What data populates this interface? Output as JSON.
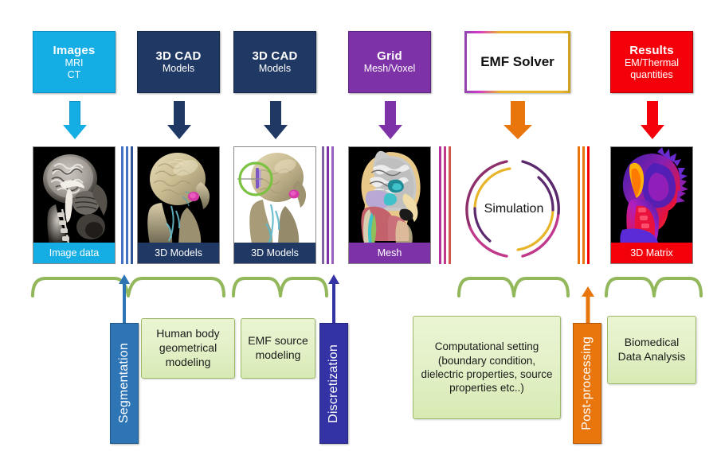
{
  "diagram": {
    "title": "EMF biomedical simulation workflow"
  },
  "sources": [
    {
      "id": "images",
      "t1": "Images",
      "t2": "MRI",
      "t3": "CT",
      "color": "#14ADE4",
      "theme": "cyan"
    },
    {
      "id": "cad1",
      "t1": "3D CAD",
      "t2": "Models",
      "t3": "",
      "color": "#1F3864",
      "theme": "navy"
    },
    {
      "id": "cad2",
      "t1": "3D CAD",
      "t2": "Models",
      "t3": "",
      "color": "#1F3864",
      "theme": "navy"
    },
    {
      "id": "grid",
      "t1": "Grid",
      "t2": "Mesh/Voxel",
      "t3": "",
      "color": "#7E32A8",
      "theme": "purple"
    },
    {
      "id": "solver",
      "t1": "EMF Solver",
      "t2": "",
      "t3": "",
      "color": "#E8B52A",
      "theme": "solver"
    },
    {
      "id": "results",
      "t1": "Results",
      "t2": "EM/Thermal",
      "t3": "quantities",
      "color": "#F4000B",
      "theme": "red"
    }
  ],
  "arrows_down": [
    {
      "for": "images",
      "color": "#14ADE4"
    },
    {
      "for": "cad1",
      "color": "#1F3864"
    },
    {
      "for": "cad2",
      "color": "#1F3864"
    },
    {
      "for": "grid",
      "color": "#7E32A8"
    },
    {
      "for": "solver",
      "color": "#E8760C"
    },
    {
      "for": "results",
      "color": "#F4000B"
    }
  ],
  "panels": [
    {
      "id": "imagedata",
      "caption": "Image data",
      "theme": "cyan",
      "art": "mri-sagittal-scan"
    },
    {
      "id": "model1",
      "caption": "3D Models",
      "theme": "navy",
      "art": "head-3d-model"
    },
    {
      "id": "model2",
      "caption": "3D Models",
      "theme": "navy",
      "art": "head-3d-model-with-source"
    },
    {
      "id": "mesh",
      "caption": "Mesh",
      "theme": "purple",
      "art": "segmented-head-mesh"
    },
    {
      "id": "matrix",
      "caption": "3D Matrix",
      "theme": "red",
      "art": "thermal-em-field-map"
    }
  ],
  "simulation": {
    "label": "Simulation",
    "ring_colors": [
      "#E8B52A",
      "#C0398A",
      "#5B2A6E",
      "#8E2F6B"
    ]
  },
  "separators": [
    {
      "after": "imagedata",
      "colors": [
        "#4472C4",
        "#4472C4",
        "#2F5597"
      ]
    },
    {
      "after": "model2",
      "colors": [
        "#8064A2",
        "#7E32A8",
        "#9B5FBF"
      ]
    },
    {
      "after": "mesh",
      "colors": [
        "#B3329E",
        "#C0398A",
        "#D2554E"
      ]
    },
    {
      "after": "simulation",
      "colors": [
        "#E8760C",
        "#E8760C",
        "#F4000B"
      ]
    }
  ],
  "process_bars": [
    {
      "id": "segmentation",
      "label": "Segmentation",
      "color": "#2E75B6",
      "theme": "seg"
    },
    {
      "id": "discretization",
      "label": "Discretization",
      "color": "#3333A6",
      "theme": "disc"
    },
    {
      "id": "postprocessing",
      "label": "Post-processing",
      "color": "#E8760C",
      "theme": "post"
    }
  ],
  "task_boxes": [
    {
      "id": "geometry",
      "text": "Human body geometrical modeling"
    },
    {
      "id": "emfsource",
      "text": "EMF source modeling"
    },
    {
      "id": "compset",
      "text": "Computational setting (boundary condition, dielectric properties, source properties etc..)"
    },
    {
      "id": "biodata",
      "text": "Biomedical Data Analysis"
    }
  ],
  "braces": [
    {
      "id": "brace-segmentation-geometry",
      "color": "#93B85C"
    },
    {
      "id": "brace-emf-source",
      "color": "#93B85C"
    },
    {
      "id": "brace-computational-setting",
      "color": "#93B85C"
    },
    {
      "id": "brace-biomedical-analysis",
      "color": "#93B85C"
    }
  ],
  "palette": {
    "cyan": "#14ADE4",
    "navy": "#1F3864",
    "purple": "#7E32A8",
    "red": "#F4000B",
    "orange": "#E8760C",
    "gold": "#E8B52A",
    "green": "#93B85C",
    "green_fill": "#E2F0C6"
  }
}
